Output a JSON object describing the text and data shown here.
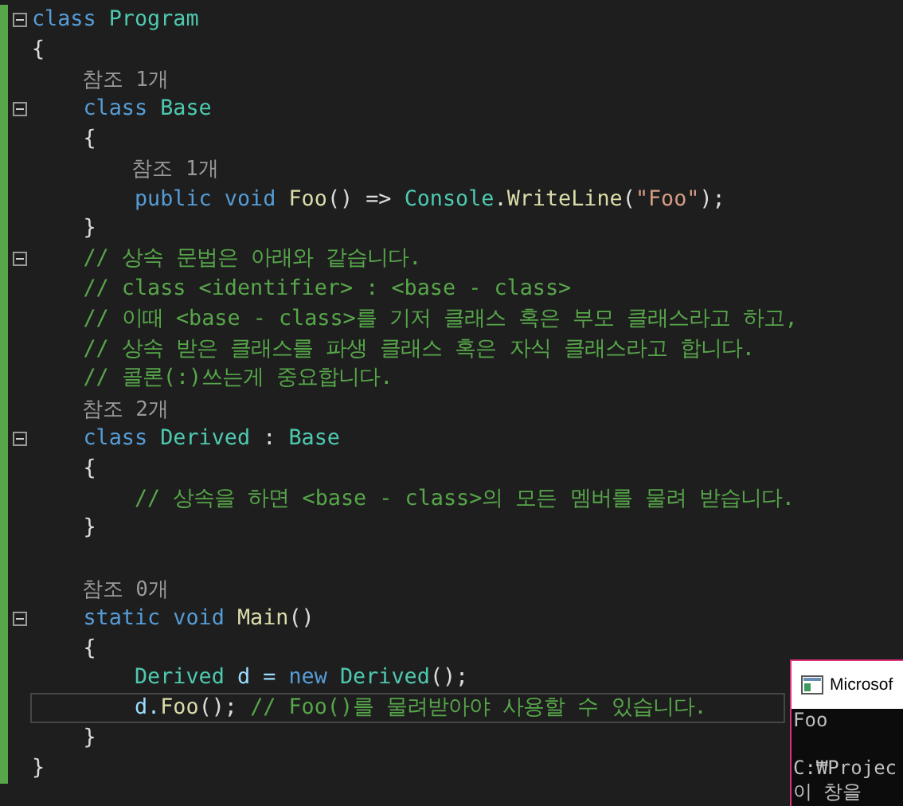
{
  "editor": {
    "lines": [
      {
        "kind": "code",
        "fold": true,
        "tokens": [
          {
            "t": "class ",
            "kind": "keyword"
          },
          {
            "t": "Program",
            "kind": "type"
          }
        ]
      },
      {
        "kind": "code",
        "tokens": [
          {
            "t": "{",
            "kind": "plain"
          }
        ]
      },
      {
        "kind": "codelens",
        "tokens": [
          {
            "t": "    참조 1개",
            "kind": "lens"
          }
        ]
      },
      {
        "kind": "code",
        "fold": true,
        "tokens": [
          {
            "t": "    class ",
            "kind": "keyword"
          },
          {
            "t": "Base",
            "kind": "type"
          }
        ]
      },
      {
        "kind": "code",
        "tokens": [
          {
            "t": "    {",
            "kind": "plain"
          }
        ]
      },
      {
        "kind": "codelens",
        "tokens": [
          {
            "t": "        참조 1개",
            "kind": "lens"
          }
        ]
      },
      {
        "kind": "code",
        "tokens": [
          {
            "t": "        public void ",
            "kind": "keyword"
          },
          {
            "t": "Foo",
            "kind": "method"
          },
          {
            "t": "() => ",
            "kind": "plain"
          },
          {
            "t": "Console",
            "kind": "type"
          },
          {
            "t": ".",
            "kind": "plain"
          },
          {
            "t": "WriteLine",
            "kind": "method"
          },
          {
            "t": "(",
            "kind": "plain"
          },
          {
            "t": "\"Foo\"",
            "kind": "string"
          },
          {
            "t": ");",
            "kind": "plain"
          }
        ]
      },
      {
        "kind": "code",
        "tokens": [
          {
            "t": "    }",
            "kind": "plain"
          }
        ]
      },
      {
        "kind": "code",
        "fold": true,
        "tokens": [
          {
            "t": "    // 상속 문법은 아래와 같습니다.",
            "kind": "comment"
          }
        ]
      },
      {
        "kind": "code",
        "tokens": [
          {
            "t": "    // class <identifier> : <base - class>",
            "kind": "comment"
          }
        ]
      },
      {
        "kind": "code",
        "tokens": [
          {
            "t": "    // 이때 <base - class>를 기저 클래스 혹은 부모 클래스라고 하고,",
            "kind": "comment"
          }
        ]
      },
      {
        "kind": "code",
        "tokens": [
          {
            "t": "    // 상속 받은 클래스를 파생 클래스 혹은 자식 클래스라고 합니다.",
            "kind": "comment"
          }
        ]
      },
      {
        "kind": "code",
        "tokens": [
          {
            "t": "    // 콜론(:)쓰는게 중요합니다.",
            "kind": "comment"
          }
        ]
      },
      {
        "kind": "codelens",
        "tokens": [
          {
            "t": "    참조 2개",
            "kind": "lens"
          }
        ]
      },
      {
        "kind": "code",
        "fold": true,
        "tokens": [
          {
            "t": "    class ",
            "kind": "keyword"
          },
          {
            "t": "Derived",
            "kind": "type"
          },
          {
            "t": " : ",
            "kind": "plain"
          },
          {
            "t": "Base",
            "kind": "type"
          }
        ]
      },
      {
        "kind": "code",
        "tokens": [
          {
            "t": "    {",
            "kind": "plain"
          }
        ]
      },
      {
        "kind": "code",
        "tokens": [
          {
            "t": "        // 상속을 하면 <base - class>의 모든 멤버를 물려 받습니다.",
            "kind": "comment"
          }
        ]
      },
      {
        "kind": "code",
        "tokens": [
          {
            "t": "    }",
            "kind": "plain"
          }
        ]
      },
      {
        "kind": "blank"
      },
      {
        "kind": "codelens",
        "tokens": [
          {
            "t": "    참조 0개",
            "kind": "lens"
          }
        ]
      },
      {
        "kind": "code",
        "fold": true,
        "tokens": [
          {
            "t": "    static void ",
            "kind": "keyword"
          },
          {
            "t": "Main",
            "kind": "method"
          },
          {
            "t": "()",
            "kind": "plain"
          }
        ]
      },
      {
        "kind": "code",
        "tokens": [
          {
            "t": "    {",
            "kind": "plain"
          }
        ]
      },
      {
        "kind": "code",
        "tokens": [
          {
            "t": "        Derived",
            "kind": "type"
          },
          {
            "t": " d = ",
            "kind": "var"
          },
          {
            "t": "new ",
            "kind": "keyword"
          },
          {
            "t": "Derived",
            "kind": "type"
          },
          {
            "t": "();",
            "kind": "plain"
          }
        ]
      },
      {
        "kind": "code",
        "current": true,
        "tokens": [
          {
            "t": "        d.",
            "kind": "var"
          },
          {
            "t": "Foo",
            "kind": "method"
          },
          {
            "t": "(); ",
            "kind": "plain"
          },
          {
            "t": "// Foo()를 물려받아야 사용할 수 있습니다.",
            "kind": "comment"
          }
        ]
      },
      {
        "kind": "code",
        "tokens": [
          {
            "t": "    }",
            "kind": "plain"
          }
        ]
      },
      {
        "kind": "code",
        "tokens": [
          {
            "t": "}",
            "kind": "plain"
          }
        ]
      }
    ]
  },
  "console": {
    "title": "Microsof",
    "lines": [
      {
        "kind": "text",
        "text": "Foo"
      },
      {
        "kind": "blank"
      },
      {
        "kind": "text",
        "text": "C:₩Projec"
      },
      {
        "kind": "text",
        "text": "이 창을"
      }
    ]
  }
}
